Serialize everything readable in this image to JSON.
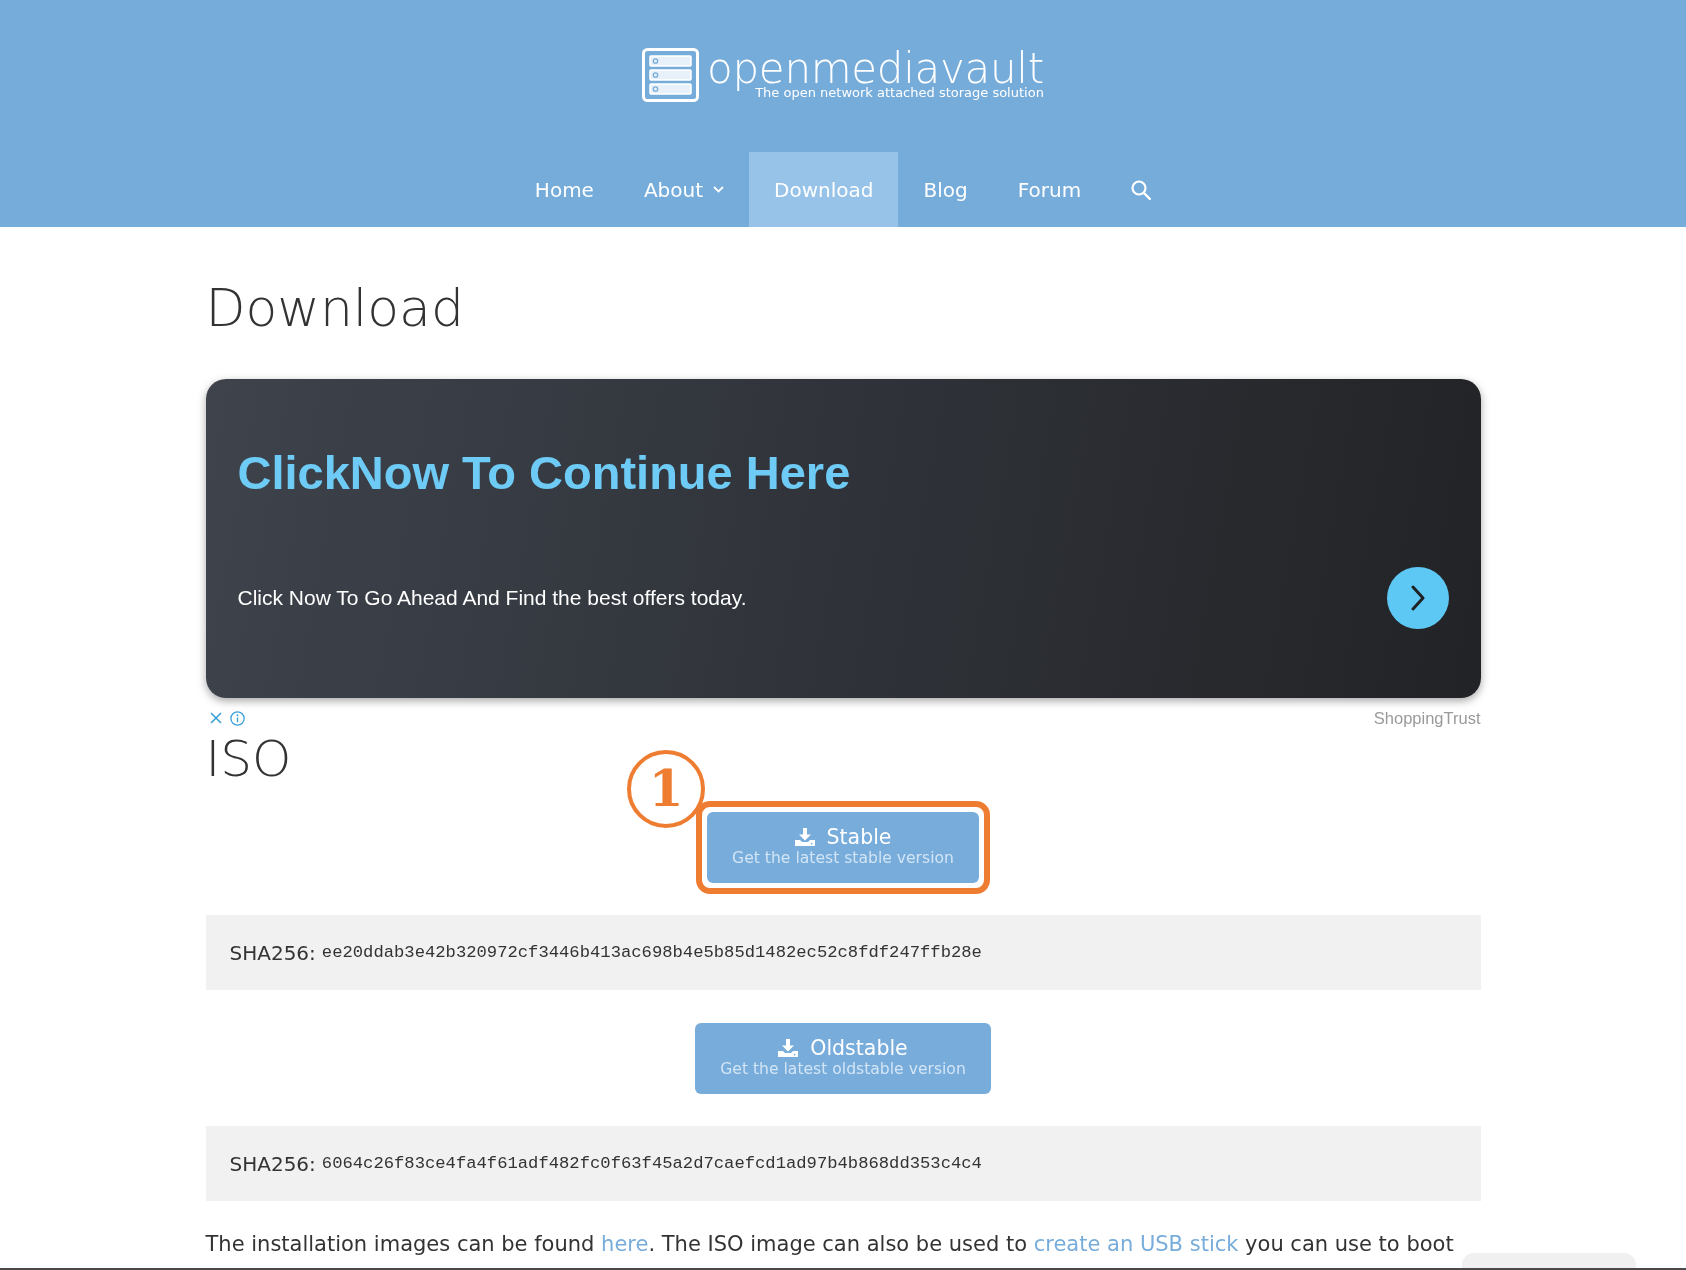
{
  "header": {
    "logo": {
      "name": "openmediavault",
      "tagline": "The open network attached storage solution"
    },
    "nav": [
      {
        "label": "Home",
        "kind": "link",
        "selected": false
      },
      {
        "label": "About",
        "kind": "dropdown",
        "selected": false
      },
      {
        "label": "Download",
        "kind": "link",
        "selected": true
      },
      {
        "label": "Blog",
        "kind": "link",
        "selected": false
      },
      {
        "label": "Forum",
        "kind": "link",
        "selected": false
      }
    ]
  },
  "page_title": "Download",
  "ad": {
    "headline": "ClickNow To Continue Here",
    "text": "Click Now To Go Ahead And Find the best offers today.",
    "sponsor": "ShoppingTrust"
  },
  "sections": [
    {
      "heading": "ISO",
      "downloads": [
        {
          "label": "Stable",
          "sublabel": "Get the latest stable version",
          "highlighted": true,
          "callout": "1",
          "checksum_label": "SHA256:",
          "checksum": "ee20ddab3e42b320972cf3446b413ac698b4e5b85d1482ec52c8fdf247ffb28e"
        },
        {
          "label": "Oldstable",
          "sublabel": "Get the latest oldstable version",
          "highlighted": false,
          "checksum_label": "SHA256:",
          "checksum": "6064c26f83ce4fa4f61adf482fc0f63f45a2d7caefcd1ad97b4b868dd353c4c4"
        }
      ]
    }
  ],
  "intro": [
    {
      "kind": "text",
      "text": "The installation images can be found "
    },
    {
      "kind": "link",
      "text": "here"
    },
    {
      "kind": "text",
      "text": ". The ISO image can also be used to "
    },
    {
      "kind": "link",
      "text": "create an USB stick"
    },
    {
      "kind": "text",
      "text": " you can use to boot"
    }
  ]
}
